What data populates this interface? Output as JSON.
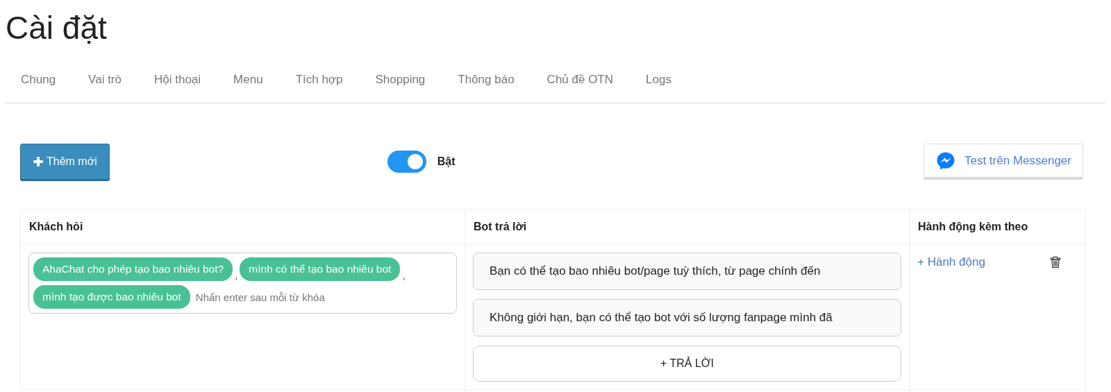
{
  "title": "Cài đặt",
  "tabs": [
    {
      "label": "Chung",
      "selected": false
    },
    {
      "label": "Vai trò",
      "selected": false
    },
    {
      "label": "Hội thoại",
      "selected": false
    },
    {
      "label": "Menu",
      "selected": false
    },
    {
      "label": "Tích hợp",
      "selected": false
    },
    {
      "label": "Shopping",
      "selected": false
    },
    {
      "label": "Thông báo",
      "selected": false
    },
    {
      "label": "Chủ đề OTN",
      "selected": false
    },
    {
      "label": "Logs",
      "selected": false
    }
  ],
  "toolbar": {
    "add_button": "Thêm mới",
    "toggle": {
      "on": true,
      "label": "Bật"
    },
    "messenger_button": "Test trên Messenger"
  },
  "table": {
    "columns": [
      "Khách hỏi",
      "Bot trả lời",
      "Hành động kèm theo"
    ],
    "rows": [
      {
        "keywords": [
          "AhaChat cho phép tạo bao nhiêu bot?",
          "mình có thể tạo bao nhiêu bot",
          "mình tạo được bao nhiêu bot"
        ],
        "keyword_separators": [
          ",",
          ","
        ],
        "keyword_placeholder": "Nhấn enter sau mỗi từ khóa",
        "replies": [
          "Bạn có thể tạo bao nhiêu bot/page tuỳ thích, từ page chính đến",
          "Không giới hạn, bạn có thể tạo bot với số lượng fanpage mình đã"
        ],
        "add_reply": "+ TRẢ LỜI",
        "action_link": "+ Hành động"
      }
    ]
  }
}
